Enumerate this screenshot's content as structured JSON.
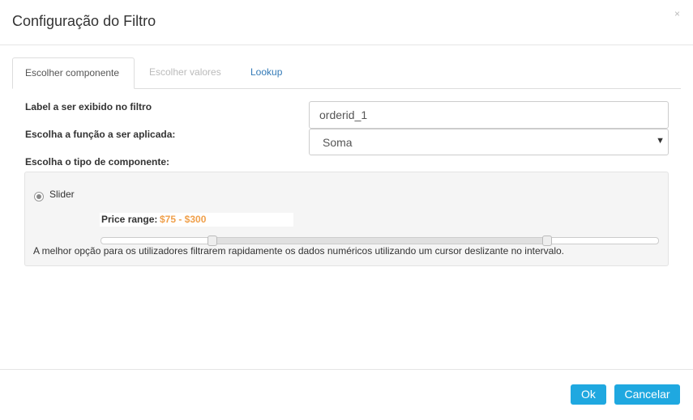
{
  "modal": {
    "title": "Configuração do Filtro",
    "close_glyph": "×"
  },
  "tabs": [
    {
      "label": "Escolher componente",
      "state": "active"
    },
    {
      "label": "Escolher valores",
      "state": "disabled"
    },
    {
      "label": "Lookup",
      "state": "link"
    }
  ],
  "form": {
    "label_field_label": "Label a ser exibido no filtro",
    "label_field_value": "orderid_1",
    "function_label": "Escolha a função a ser aplicada:",
    "function_value": "Soma",
    "component_type_label": "Escolha o tipo de componente:"
  },
  "component": {
    "option_label": "Slider",
    "selected": true,
    "price_label": "Price range:",
    "price_value": "$75 - $300",
    "range_min_fraction": 0.2,
    "range_max_fraction": 0.8,
    "help_text": "A melhor opção para os utilizadores filtrarem rapidamente os dados numéricos utilizando um cursor deslizante no intervalo."
  },
  "footer": {
    "ok_label": "Ok",
    "cancel_label": "Cancelar"
  },
  "colors": {
    "accent": "#1fa8e0",
    "price": "#f0a04b",
    "link": "#337ab7"
  }
}
